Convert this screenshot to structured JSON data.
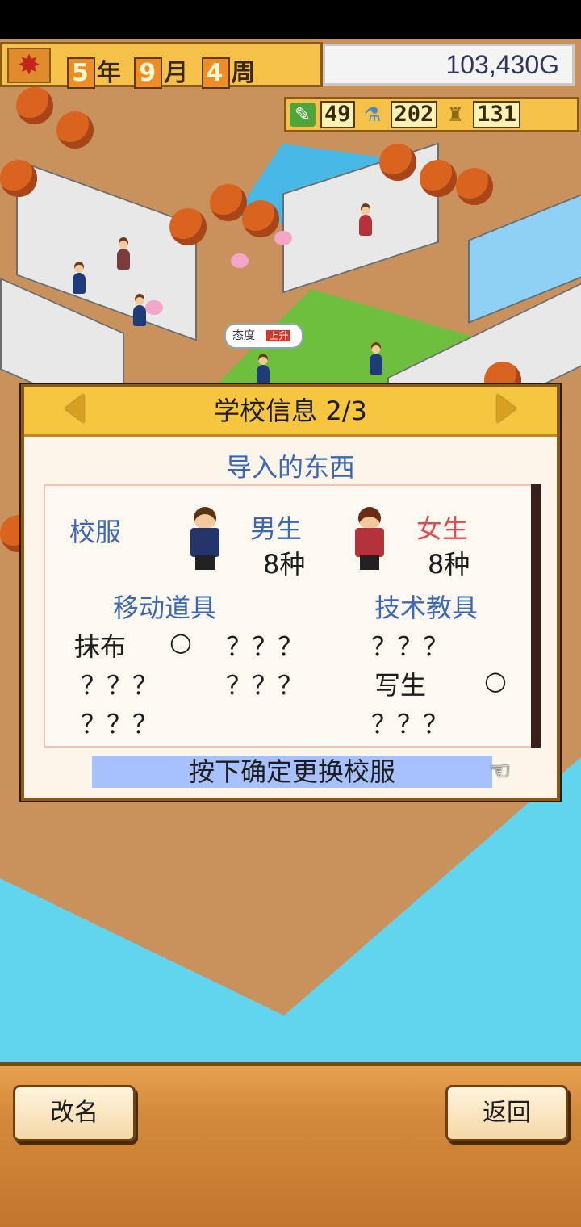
{
  "hud": {
    "year": "5",
    "year_unit": "年",
    "month": "9",
    "month_unit": "月",
    "week": "4",
    "week_unit": "周",
    "money": "103,430G",
    "stats": [
      {
        "icon": "pencil-icon",
        "value": "49"
      },
      {
        "icon": "flask-icon",
        "value": "202"
      },
      {
        "icon": "trophy-icon",
        "value": "131"
      }
    ]
  },
  "scene": {
    "attitude_label": "态度",
    "attitude_badge": "上升"
  },
  "dialog": {
    "title": "学校信息 2/3",
    "section": "导入的东西",
    "uniform": {
      "label": "校服",
      "male_label": "男生",
      "male_count": "8种",
      "female_label": "女生",
      "female_count": "8种"
    },
    "mobile_items": {
      "header": "移动道具",
      "col1": [
        {
          "name": "抹布",
          "mark": "○"
        },
        {
          "name": "？？？",
          "mark": ""
        },
        {
          "name": "？？？",
          "mark": ""
        }
      ],
      "col2": [
        {
          "name": "？？？"
        },
        {
          "name": "？？？"
        }
      ]
    },
    "tech_tools": {
      "header": "技术教具",
      "items": [
        {
          "name": "？？？",
          "mark": ""
        },
        {
          "name": "写生",
          "mark": "○"
        },
        {
          "name": "？？？",
          "mark": ""
        }
      ]
    },
    "confirm": "按下确定更换校服"
  },
  "bottom": {
    "rename": "改名",
    "back": "返回"
  },
  "colors": {
    "hud_gold": "#f5c148",
    "dialog_bg": "#fcf6ea",
    "heading_blue": "#3b67b8",
    "female_red": "#e04b52",
    "confirm_highlight": "#a7c1ff",
    "water": "#61d5ee"
  }
}
